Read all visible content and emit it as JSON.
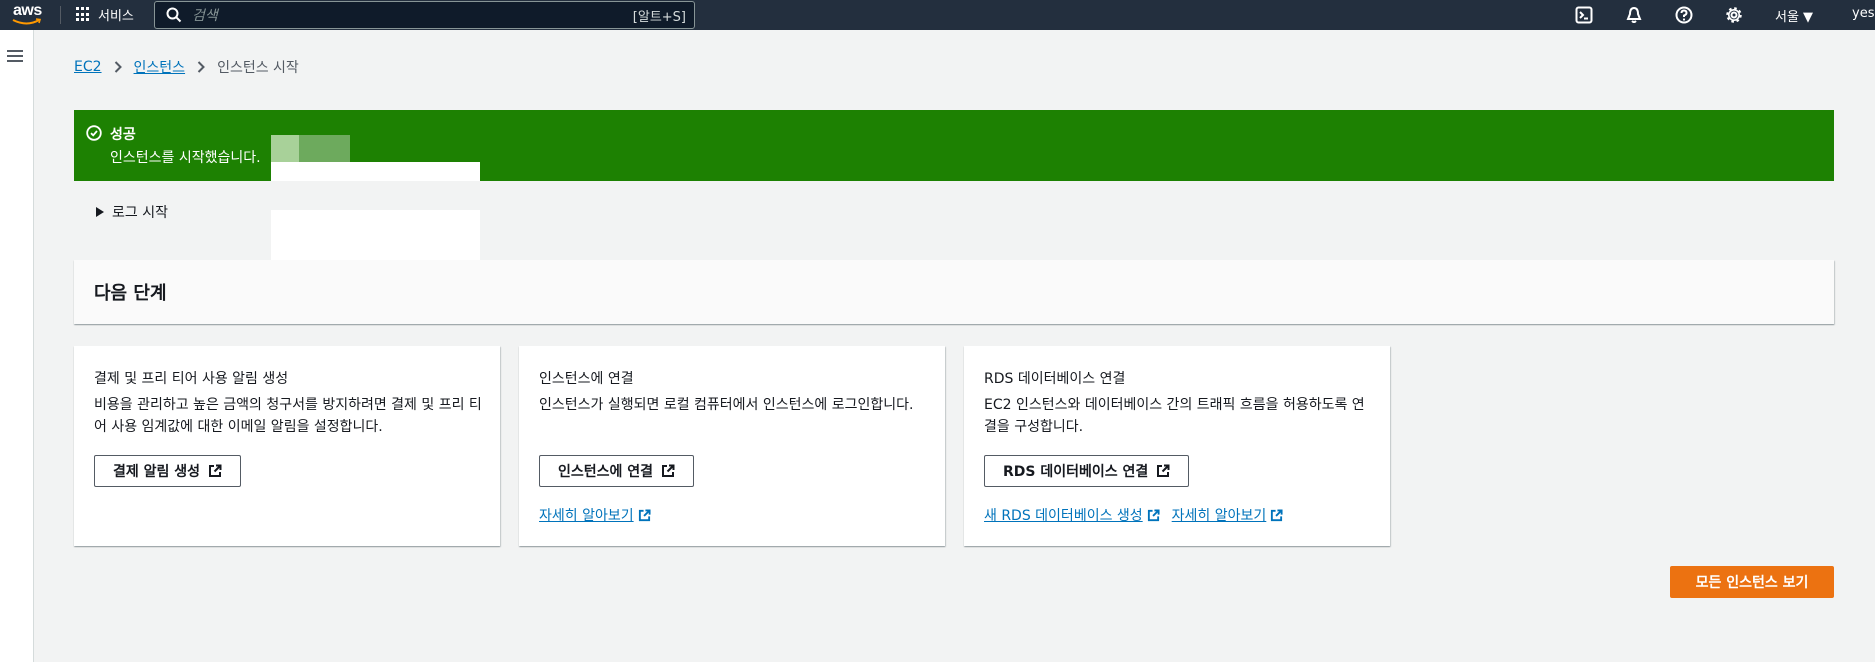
{
  "nav": {
    "logo": "aws",
    "services_label": "서비스",
    "search_placeholder": "검색",
    "search_shortcut": "[알트+S]",
    "icons": [
      "cloudshell-icon",
      "notifications-icon",
      "help-icon",
      "settings-icon"
    ],
    "region": "서울 ▼",
    "user": "yese"
  },
  "breadcrumb": {
    "items": [
      "EC2",
      "인스턴스",
      "인스턴스 시작"
    ]
  },
  "flash": {
    "title": "성공",
    "message": "인스턴스를 시작했습니다.",
    "color": "#1d8102"
  },
  "log": {
    "label": "로그 시작"
  },
  "next_steps": {
    "title": "다음 단계"
  },
  "cards": [
    {
      "title": "결제 및 프리 티어 사용 알림 생성",
      "description": "비용을 관리하고 높은 금액의 청구서를 방지하려면 결제 및 프리 티어 사용 임계값에 대한 이메일 알림을 설정합니다.",
      "button": "결제 알림 생성",
      "links": []
    },
    {
      "title": "인스턴스에 연결",
      "description": "인스턴스가 실행되면 로컬 컴퓨터에서 인스턴스에 로그인합니다.",
      "button": "인스턴스에 연결",
      "links": [
        "자세히 알아보기"
      ]
    },
    {
      "title": "RDS 데이터베이스 연결",
      "description": "EC2 인스턴스와 데이터베이스 간의 트래픽 흐름을 허용하도록 연결을 구성합니다.",
      "button": "RDS 데이터베이스 연결",
      "links": [
        "새 RDS 데이터베이스 생성",
        "자세히 알아보기"
      ]
    }
  ],
  "primary_button": "모든 인스턴스 보기",
  "colors": {
    "nav_bg": "#232f3e",
    "link": "#0073bb",
    "primary": "#ec7211",
    "success": "#1d8102"
  }
}
